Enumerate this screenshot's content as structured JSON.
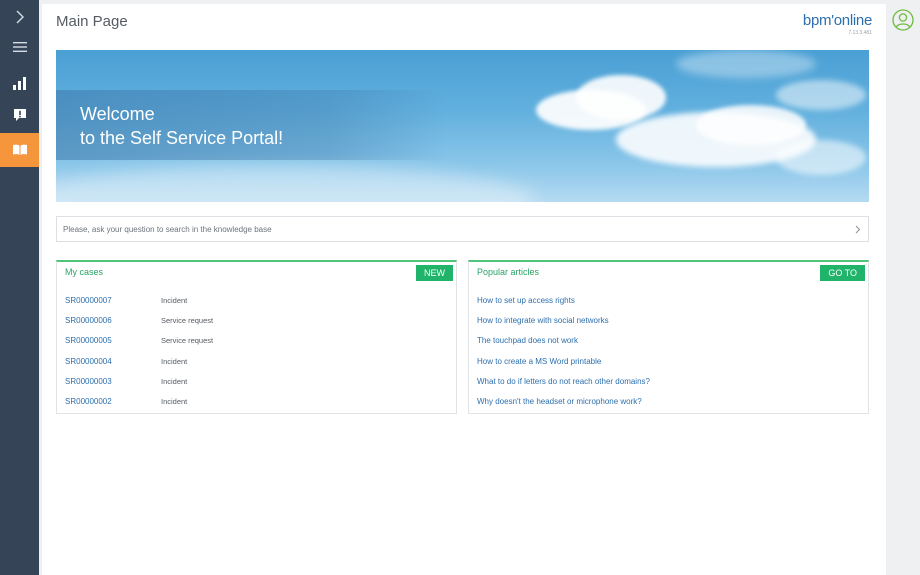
{
  "header": {
    "title": "Main Page",
    "logo_text": "bpm'online",
    "version": "7.13.3.481"
  },
  "sidebar": {
    "items": [
      {
        "name": "expand",
        "icon": "chevron-right-icon"
      },
      {
        "name": "menu",
        "icon": "hamburger-icon"
      },
      {
        "name": "dashboards",
        "icon": "bar-chart-icon"
      },
      {
        "name": "cases",
        "icon": "exclamation-icon"
      },
      {
        "name": "knowledge-base",
        "icon": "book-icon",
        "active": true
      }
    ]
  },
  "banner": {
    "line1": "Welcome",
    "line2": "to the Self Service Portal!"
  },
  "search": {
    "placeholder": "Please, ask your question to search in the knowledge base"
  },
  "my_cases": {
    "title": "My cases",
    "button": "NEW",
    "rows": [
      {
        "id": "SR00000007",
        "type": "Incident"
      },
      {
        "id": "SR00000006",
        "type": "Service request"
      },
      {
        "id": "SR00000005",
        "type": "Service request"
      },
      {
        "id": "SR00000004",
        "type": "Incident"
      },
      {
        "id": "SR00000003",
        "type": "Incident"
      },
      {
        "id": "SR00000002",
        "type": "Incident"
      }
    ]
  },
  "popular_articles": {
    "title": "Popular articles",
    "button": "GO TO",
    "items": [
      "How to set up access rights",
      "How to integrate with social networks",
      "The touchpad does not work",
      "How to create a MS Word printable",
      "What to do if letters do not reach other domains?",
      "Why doesn't the headset or microphone work?"
    ]
  },
  "colors": {
    "sidebar": "#364458",
    "active_accent": "#f6963c",
    "panel_accent": "#1fb46a",
    "link": "#2d6fad"
  }
}
